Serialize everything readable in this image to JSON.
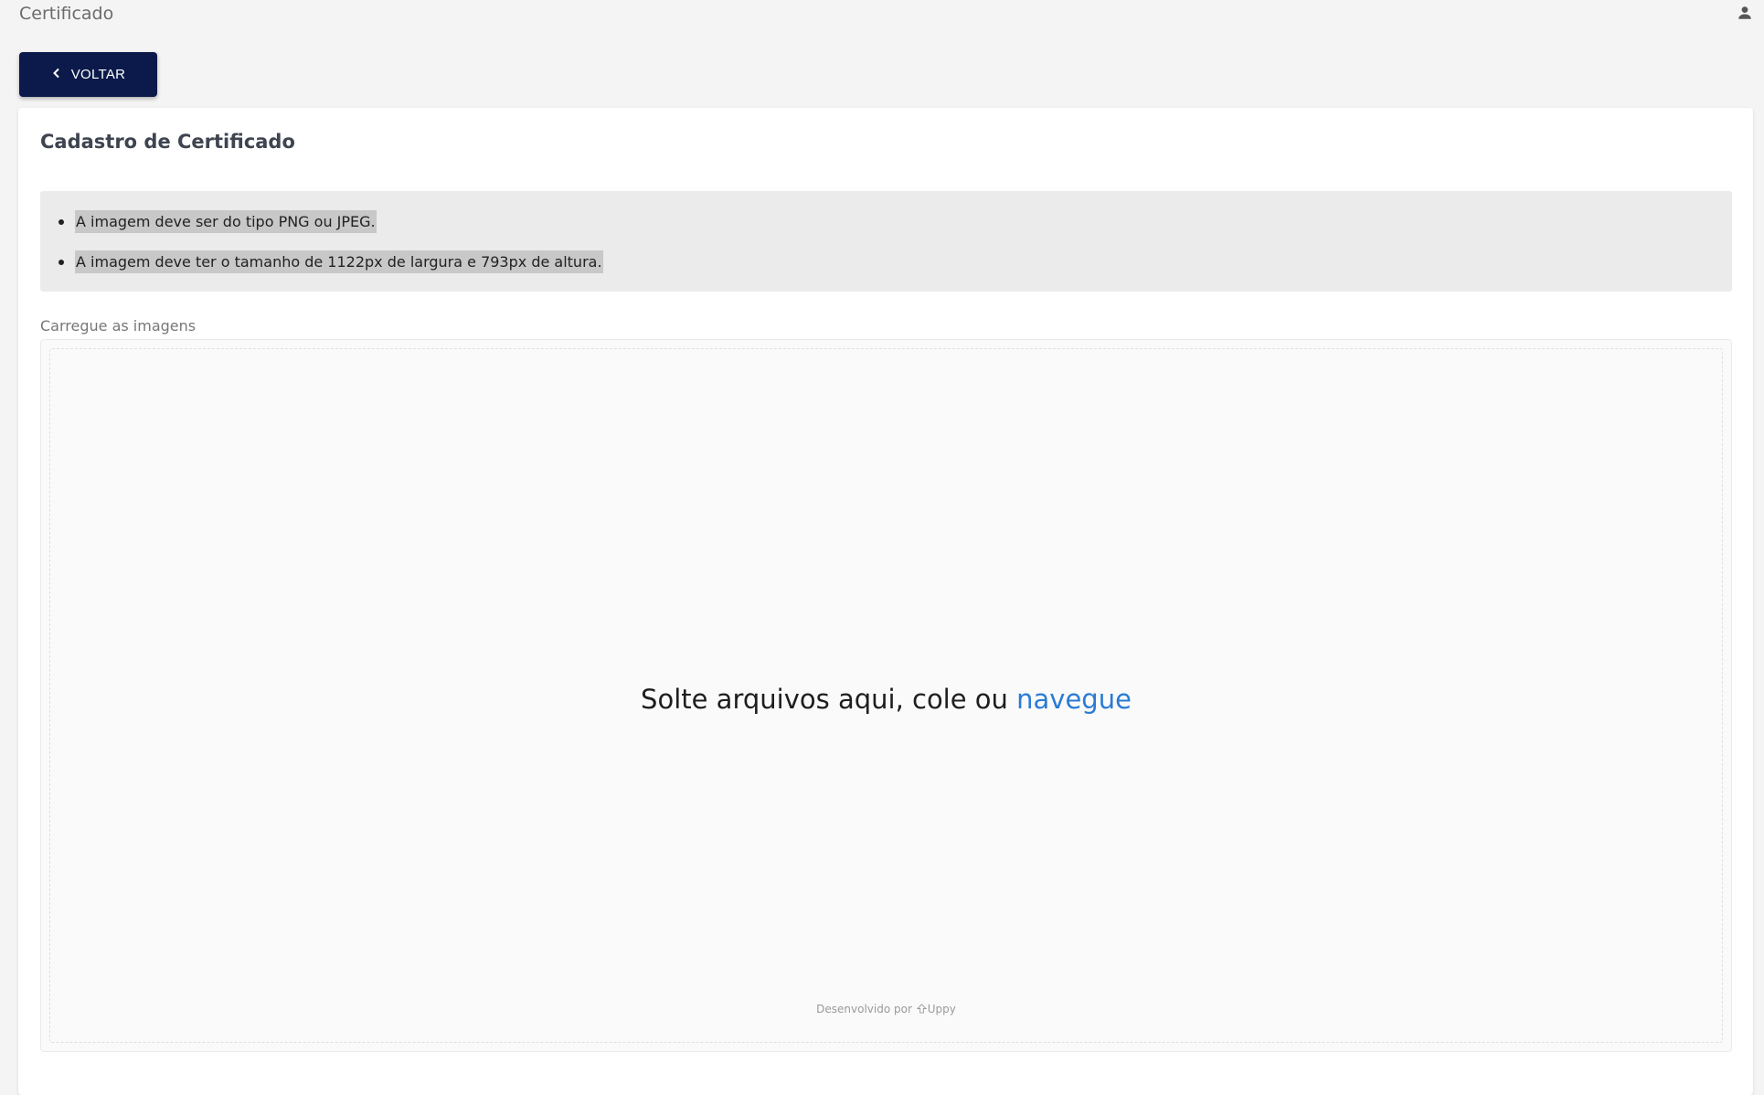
{
  "header": {
    "title": "Certificado",
    "user_icon": "person-icon"
  },
  "back_button": {
    "label": "VOLTAR",
    "icon": "chevron-left-icon"
  },
  "card": {
    "title": "Cadastro de Certificado",
    "notices": [
      "A imagem deve ser do tipo PNG ou JPEG.",
      "A imagem deve ter o tamanho de 1122px de largura e 793px de altura."
    ],
    "upload_label": "Carregue as imagens",
    "dropzone": {
      "text": "Solte arquivos aqui, cole ou",
      "browse_label": "navegue",
      "powered_by": "Desenvolvido por",
      "brand": "Uppy"
    }
  },
  "colors": {
    "primary_button": "#0b1a4a",
    "link": "#2b7bd4",
    "background": "#f4f4f4"
  }
}
